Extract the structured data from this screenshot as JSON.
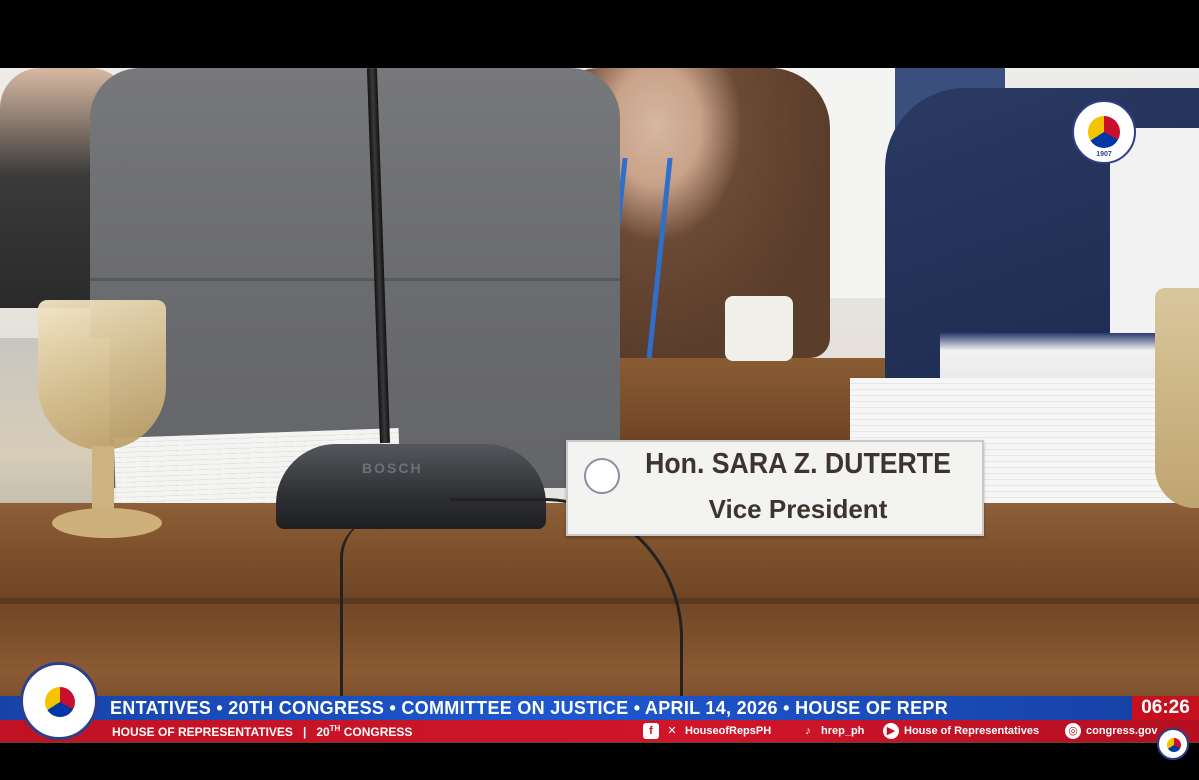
{
  "nameplate": {
    "name": "Hon. SARA Z. DUTERTE",
    "title": "Vice President"
  },
  "mic_brand": "BOSCH",
  "seal": {
    "year": "1907"
  },
  "ticker": {
    "headline": "ENTATIVES  •  20TH CONGRESS  •  COMMITTEE ON JUSTICE  •  APRIL 14, 2026  •  HOUSE OF REPR",
    "sub_left": "HOUSE OF REPRESENTATIVES",
    "sub_sep": "|",
    "sub_congress_num": "20",
    "sub_congress_sup": "TH",
    "sub_congress_word": "CONGRESS",
    "clock": "06:26",
    "social": {
      "fb_x_handle": "HouseofRepsPH",
      "tiktok_handle": "hrep_ph",
      "youtube_handle": "House of Representatives",
      "web": "congress.gov"
    }
  },
  "icons": [
    "facebook-icon",
    "x-icon",
    "tiktok-icon",
    "youtube-icon",
    "globe-icon"
  ],
  "colors": {
    "ticker_blue": "#1d57d0",
    "ticker_red": "#c01224",
    "nameplate_text": "#3d342f"
  }
}
